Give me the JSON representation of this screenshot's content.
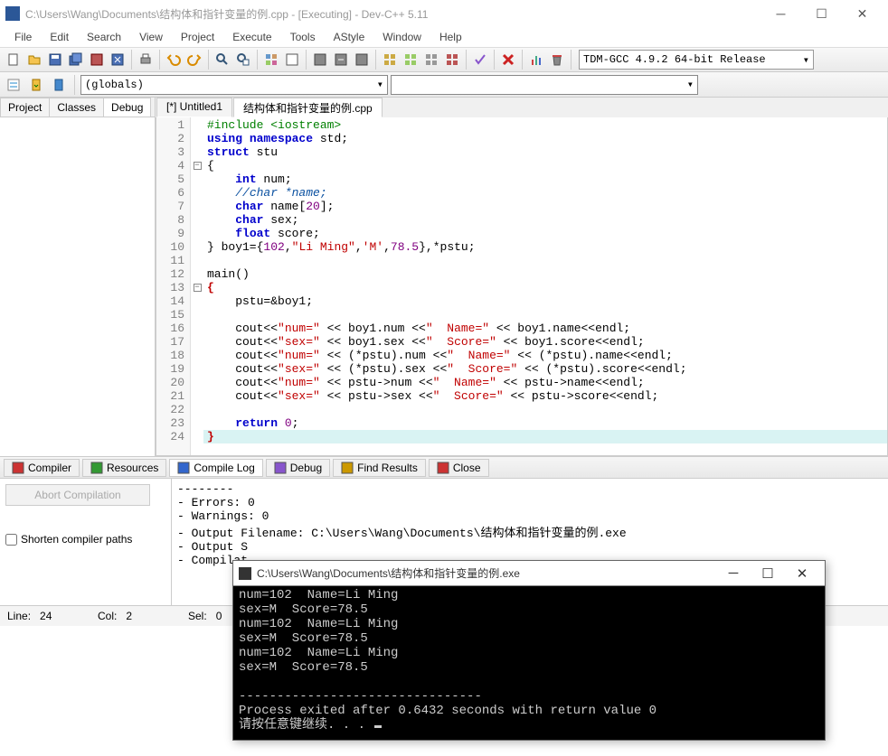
{
  "window": {
    "title": "C:\\Users\\Wang\\Documents\\结构体和指针变量的例.cpp - [Executing] - Dev-C++ 5.11"
  },
  "menubar": [
    "File",
    "Edit",
    "Search",
    "View",
    "Project",
    "Execute",
    "Tools",
    "AStyle",
    "Window",
    "Help"
  ],
  "compiler_selector": "TDM-GCC 4.9.2 64-bit Release",
  "scope_selector": "(globals)",
  "left_tabs": {
    "items": [
      "Project",
      "Classes",
      "Debug"
    ],
    "active": 2
  },
  "file_tabs": {
    "items": [
      "[*] Untitled1",
      "结构体和指针变量的例.cpp"
    ],
    "active": 1
  },
  "code": {
    "lines": [
      {
        "n": 1,
        "html": "<span class='pp'>#include &lt;iostream&gt;</span>"
      },
      {
        "n": 2,
        "html": "<span class='kw'>using</span> <span class='kw'>namespace</span> std;"
      },
      {
        "n": 3,
        "html": "<span class='kw'>struct</span> stu"
      },
      {
        "n": 4,
        "html": "{",
        "fold": true
      },
      {
        "n": 5,
        "html": "    <span class='kw'>int</span> num;"
      },
      {
        "n": 6,
        "html": "    <span class='cmt'>//char *name;</span>"
      },
      {
        "n": 7,
        "html": "    <span class='kw'>char</span> name[<span class='num'>20</span>];"
      },
      {
        "n": 8,
        "html": "    <span class='kw'>char</span> sex;"
      },
      {
        "n": 9,
        "html": "    <span class='kw'>float</span> score;"
      },
      {
        "n": 10,
        "html": "} boy1={<span class='num'>102</span>,<span class='str'>\"Li Ming\"</span>,<span class='str'>'M'</span>,<span class='num'>78.5</span>},*pstu;"
      },
      {
        "n": 11,
        "html": ""
      },
      {
        "n": 12,
        "html": "main()"
      },
      {
        "n": 13,
        "html": "<span class='op'>{</span>",
        "fold": true
      },
      {
        "n": 14,
        "html": "    pstu=&amp;boy1;"
      },
      {
        "n": 15,
        "html": ""
      },
      {
        "n": 16,
        "html": "    cout&lt;&lt;<span class='str'>\"num=\"</span> &lt;&lt; boy1.num &lt;&lt;<span class='str'>\"  Name=\"</span> &lt;&lt; boy1.name&lt;&lt;endl;"
      },
      {
        "n": 17,
        "html": "    cout&lt;&lt;<span class='str'>\"sex=\"</span> &lt;&lt; boy1.sex &lt;&lt;<span class='str'>\"  Score=\"</span> &lt;&lt; boy1.score&lt;&lt;endl;"
      },
      {
        "n": 18,
        "html": "    cout&lt;&lt;<span class='str'>\"num=\"</span> &lt;&lt; (*pstu).num &lt;&lt;<span class='str'>\"  Name=\"</span> &lt;&lt; (*pstu).name&lt;&lt;endl;"
      },
      {
        "n": 19,
        "html": "    cout&lt;&lt;<span class='str'>\"sex=\"</span> &lt;&lt; (*pstu).sex &lt;&lt;<span class='str'>\"  Score=\"</span> &lt;&lt; (*pstu).score&lt;&lt;endl;"
      },
      {
        "n": 20,
        "html": "    cout&lt;&lt;<span class='str'>\"num=\"</span> &lt;&lt; pstu-&gt;num &lt;&lt;<span class='str'>\"  Name=\"</span> &lt;&lt; pstu-&gt;name&lt;&lt;endl;"
      },
      {
        "n": 21,
        "html": "    cout&lt;&lt;<span class='str'>\"sex=\"</span> &lt;&lt; pstu-&gt;sex &lt;&lt;<span class='str'>\"  Score=\"</span> &lt;&lt; pstu-&gt;score&lt;&lt;endl;"
      },
      {
        "n": 22,
        "html": ""
      },
      {
        "n": 23,
        "html": "    <span class='kw'>return</span> <span class='num'>0</span>;"
      },
      {
        "n": 24,
        "html": "<span class='op'>}</span>",
        "current": true
      }
    ]
  },
  "bottom_tabs": {
    "items": [
      "Compiler",
      "Resources",
      "Compile Log",
      "Debug",
      "Find Results",
      "Close"
    ],
    "active": 2
  },
  "abort_btn": "Abort Compilation",
  "shorten_cb": "Shorten compiler paths",
  "compile_log": "--------\n- Errors: 0\n- Warnings: 0\n- Output Filename: C:\\Users\\Wang\\Documents\\结构体和指针变量的例.exe\n- Output S\n- Compilat",
  "statusbar": {
    "line_label": "Line:",
    "line": "24",
    "col_label": "Col:",
    "col": "2",
    "sel_label": "Sel:",
    "sel": "0"
  },
  "console": {
    "title": "C:\\Users\\Wang\\Documents\\结构体和指针变量的例.exe",
    "body": "num=102  Name=Li Ming\nsex=M  Score=78.5\nnum=102  Name=Li Ming\nsex=M  Score=78.5\nnum=102  Name=Li Ming\nsex=M  Score=78.5\n\n--------------------------------\nProcess exited after 0.6432 seconds with return value 0\n请按任意键继续. . . "
  }
}
